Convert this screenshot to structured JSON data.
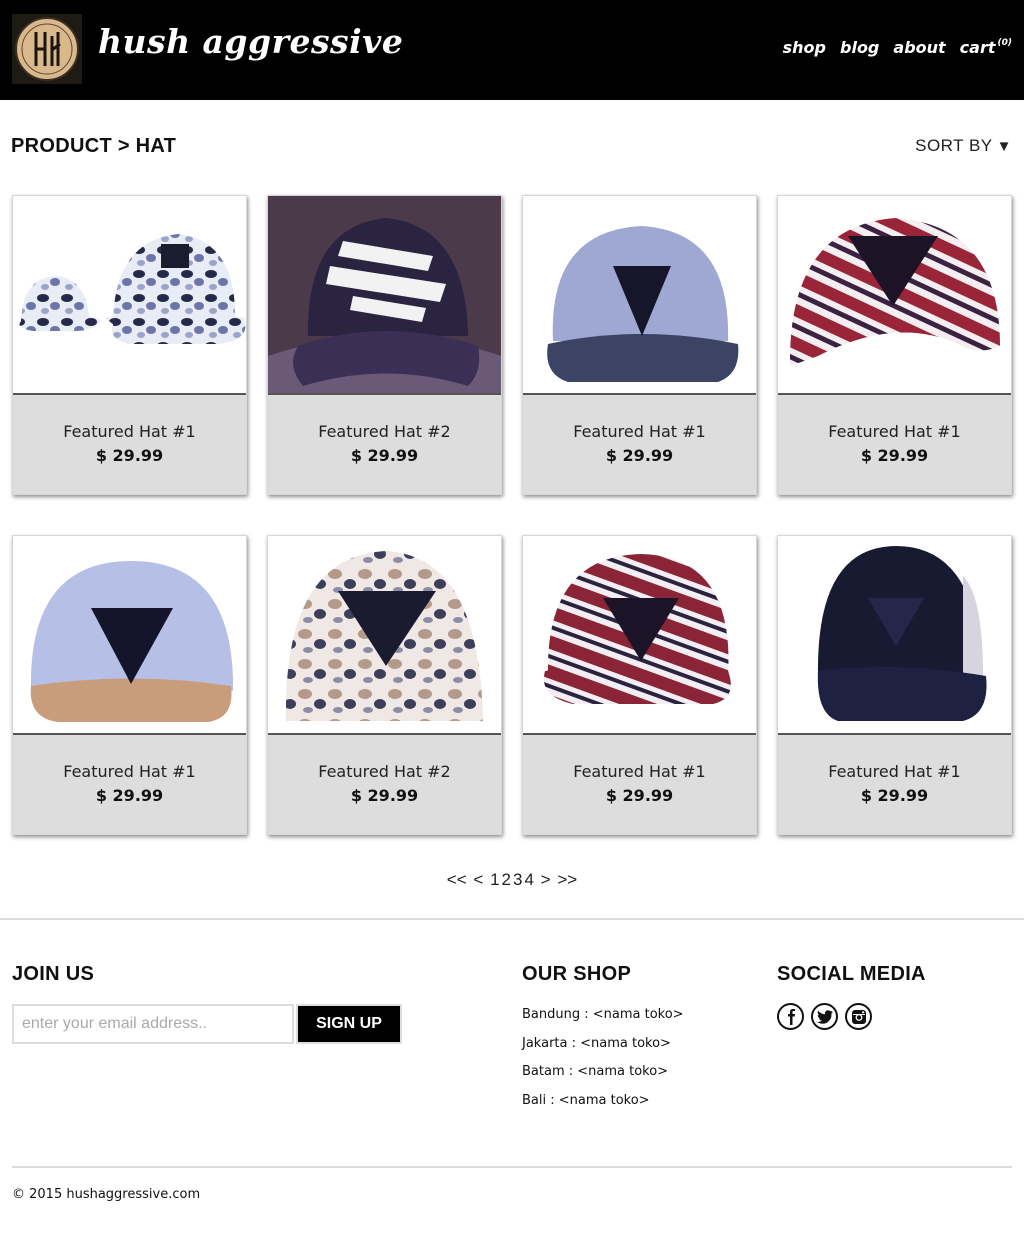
{
  "header": {
    "logo_alt": "HS",
    "brand": "hush aggressive",
    "nav": [
      {
        "label": "shop"
      },
      {
        "label": "blog"
      },
      {
        "label": "about"
      },
      {
        "label": "cart",
        "count": "(0)"
      }
    ]
  },
  "breadcrumb": "PRODUCT > HAT",
  "sort": {
    "label": "SORT BY",
    "arrow": "▼"
  },
  "products": [
    {
      "name": "Featured Hat #1",
      "price": "$ 29.99",
      "image": "camo-bucket-hats"
    },
    {
      "name": "Featured Hat #2",
      "price": "$ 29.99",
      "image": "navy-snapback-ribbon"
    },
    {
      "name": "Featured Hat #1",
      "price": "$ 29.99",
      "image": "grey-snapback-triangle"
    },
    {
      "name": "Featured Hat #1",
      "price": "$ 29.99",
      "image": "red-stripe-cap"
    },
    {
      "name": "Featured Hat #1",
      "price": "$ 29.99",
      "image": "lightblue-snapback-suede"
    },
    {
      "name": "Featured Hat #2",
      "price": "$ 29.99",
      "image": "desert-camo-cap"
    },
    {
      "name": "Featured Hat #1",
      "price": "$ 29.99",
      "image": "red-stripe-snapback"
    },
    {
      "name": "Featured Hat #1",
      "price": "$ 29.99",
      "image": "black-5panel"
    }
  ],
  "pagination": {
    "first": "<<",
    "prev": "<",
    "pages": [
      "1",
      "2",
      "3",
      "4"
    ],
    "next": ">",
    "last": ">>"
  },
  "footer": {
    "join": {
      "heading": "JOIN US",
      "placeholder": "enter your email address..",
      "button": "SIGN UP"
    },
    "shop": {
      "heading": "OUR SHOP",
      "locations": [
        "Bandung : <nama toko>",
        "Jakarta : <nama toko>",
        "Batam : <nama toko>",
        "Bali : <nama toko>"
      ]
    },
    "social": {
      "heading": "SOCIAL MEDIA",
      "icons": [
        "facebook-icon",
        "twitter-icon",
        "instagram-icon"
      ]
    },
    "copyright": "© 2015 hushaggressive.com"
  }
}
